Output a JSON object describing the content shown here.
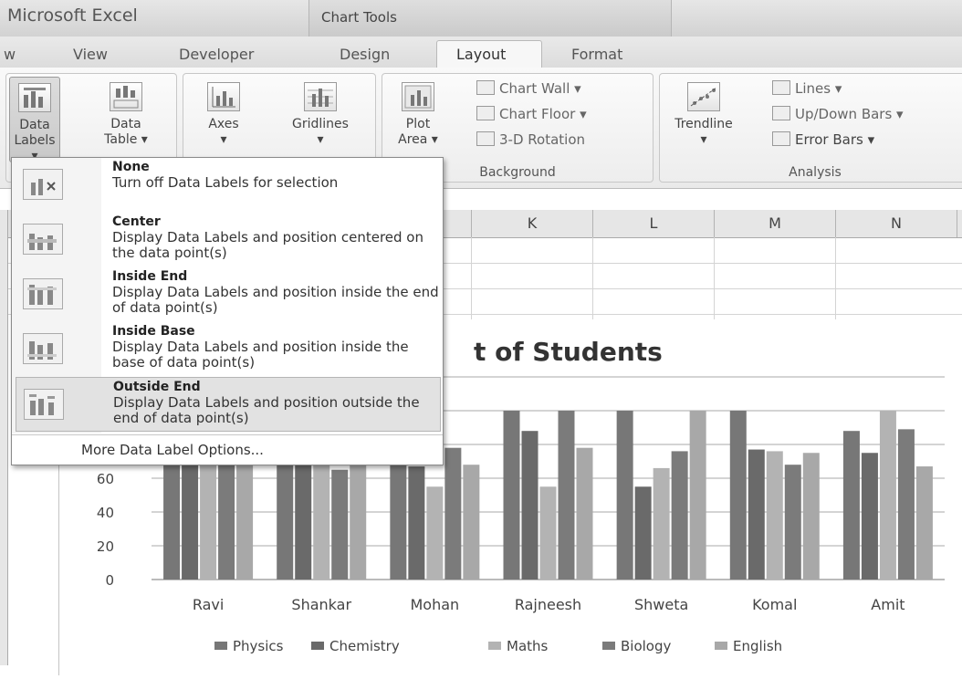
{
  "window": {
    "app_title": "Microsoft Excel",
    "context_tab_title": "Chart Tools"
  },
  "tabs": [
    "w",
    "View",
    "Developer",
    "Design",
    "Layout",
    "Format"
  ],
  "ribbon": {
    "buttons": {
      "data_labels": [
        "Data",
        "Labels ▾"
      ],
      "data_table": [
        "Data",
        "Table ▾"
      ],
      "axes": [
        "Axes",
        "▾"
      ],
      "gridlines": [
        "Gridlines",
        "▾"
      ],
      "plot_area": [
        "Plot",
        "Area ▾"
      ],
      "trendline": [
        "Trendline",
        "▾"
      ]
    },
    "background_items": [
      "Chart Wall ▾",
      "Chart Floor ▾",
      "3-D Rotation"
    ],
    "analysis_items": [
      "Lines ▾",
      "Up/Down Bars ▾",
      "Error Bars ▾"
    ],
    "groups": {
      "background": "Background",
      "analysis": "Analysis"
    }
  },
  "columns": [
    "K",
    "L",
    "M",
    "N"
  ],
  "menu": {
    "items": [
      {
        "title": "None",
        "desc": "Turn off Data Labels for selection",
        "icon": "no-labels-icon"
      },
      {
        "title": "Center",
        "desc": "Display Data Labels and position centered on the data point(s)",
        "icon": "center-labels-icon"
      },
      {
        "title": "Inside End",
        "desc": "Display Data Labels and position inside the end of data point(s)",
        "icon": "inside-end-labels-icon"
      },
      {
        "title": "Inside Base",
        "desc": "Display Data Labels and position inside the base of data point(s)",
        "icon": "inside-base-labels-icon"
      },
      {
        "title": "Outside End",
        "desc": "Display Data Labels and position outside the end of data point(s)",
        "icon": "outside-end-labels-icon",
        "highlighted": true
      }
    ],
    "more_options": "More Data Label Options..."
  },
  "chart_data": {
    "type": "bar",
    "title": "t of Students",
    "categories": [
      "Ravi",
      "Shankar",
      "Mohan",
      "Rajneesh",
      "Shweta",
      "Komal",
      "Amit"
    ],
    "series": [
      {
        "name": "Physics",
        "values": [
          80,
          70,
          80,
          100,
          100,
          100,
          88
        ]
      },
      {
        "name": "Chemistry",
        "values": [
          80,
          70,
          67,
          88,
          55,
          77,
          75
        ]
      },
      {
        "name": "Maths",
        "values": [
          80,
          80,
          55,
          55,
          66,
          76,
          100
        ]
      },
      {
        "name": "Biology",
        "values": [
          80,
          65,
          78,
          100,
          76,
          68,
          89
        ]
      },
      {
        "name": "English",
        "values": [
          80,
          75,
          68,
          78,
          100,
          75,
          67
        ]
      }
    ],
    "yticks": [
      "0",
      "20",
      "40",
      "60"
    ],
    "ylim": [
      0,
      100
    ],
    "colors": [
      "#777777",
      "#6a6a6a",
      "#b3b3b3",
      "#7b7b7b",
      "#a8a8a8"
    ],
    "grid": true,
    "legend_position": "bottom"
  }
}
